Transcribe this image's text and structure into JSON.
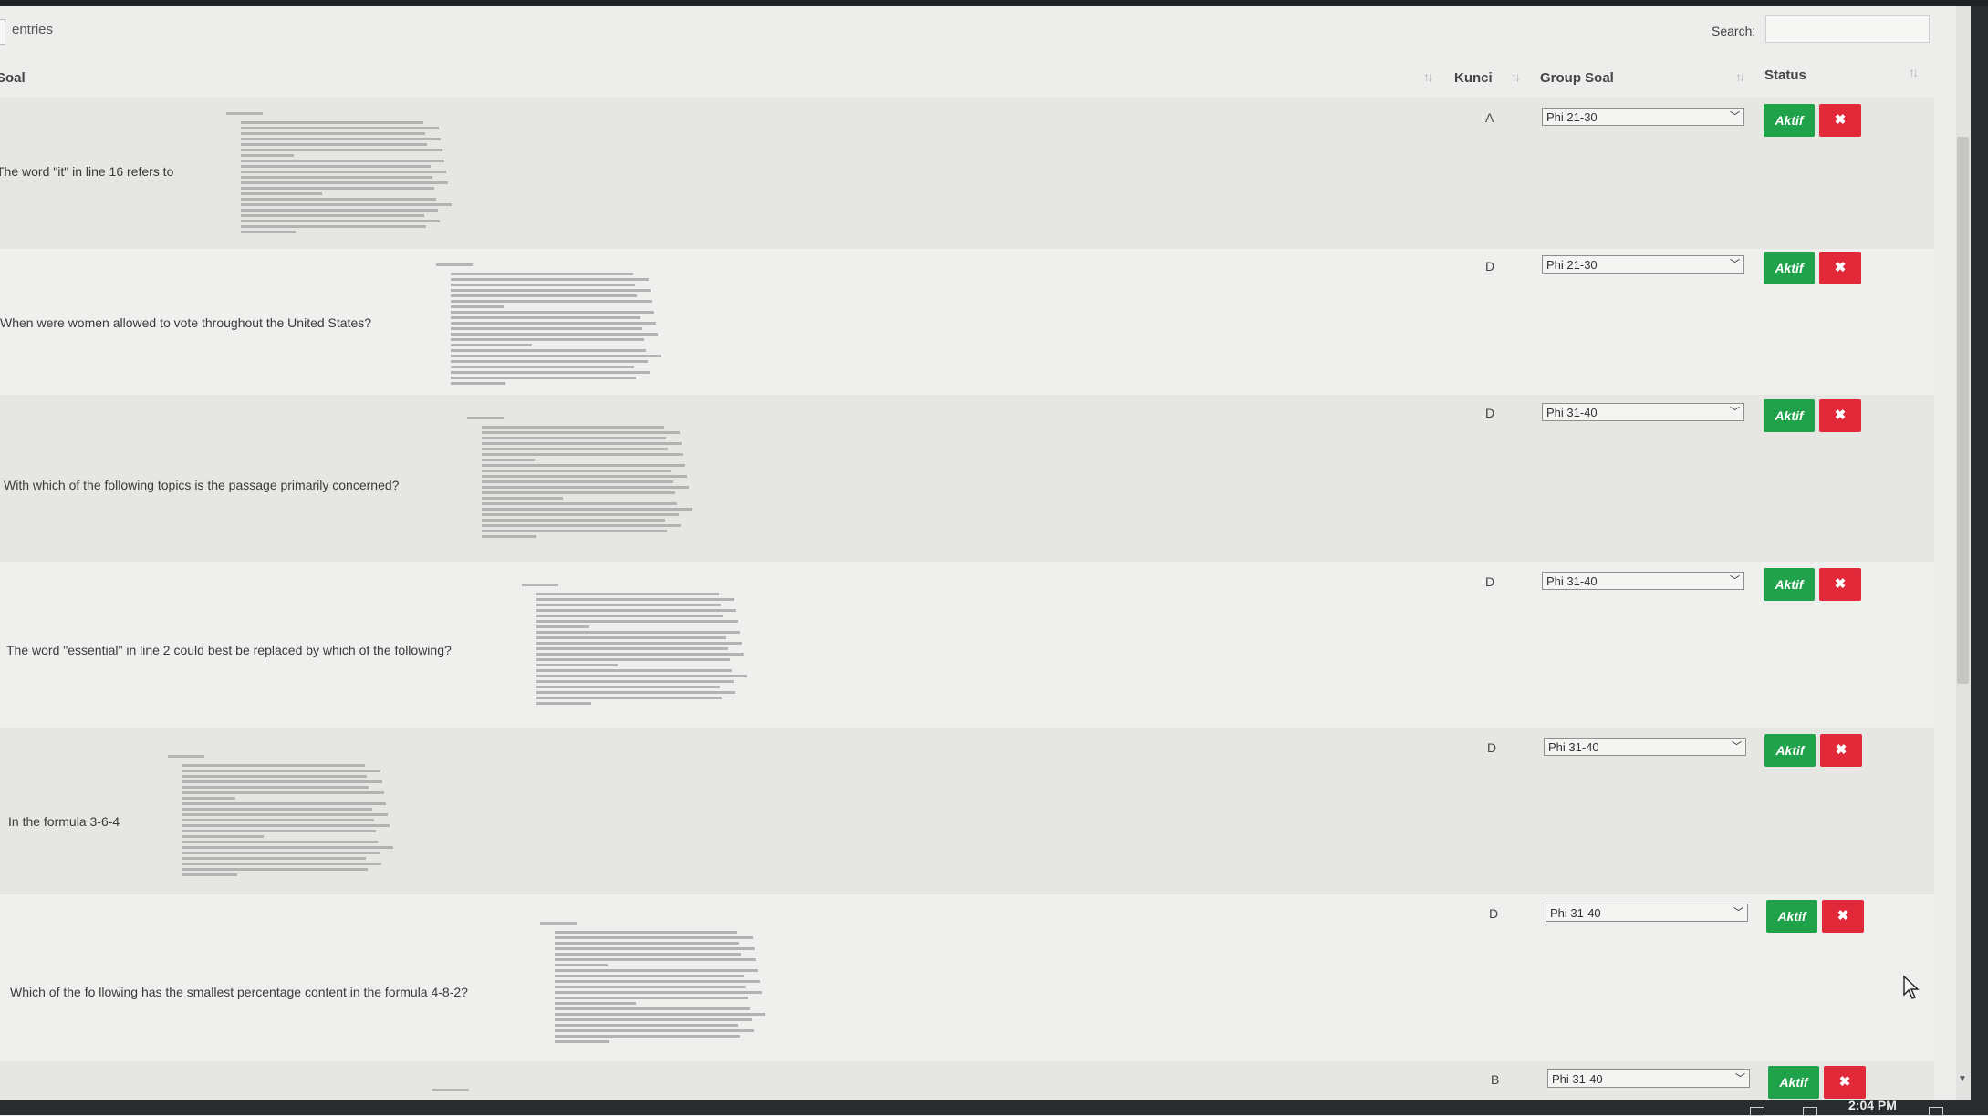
{
  "controls": {
    "entries_label": "entries",
    "search_label": "Search:",
    "search_value": ""
  },
  "table": {
    "headers": {
      "soal": "Soal",
      "kunci": "Kunci",
      "group_soal": "Group Soal",
      "status": "Status"
    },
    "rows": [
      {
        "question": "The word \"it\" in line 16 refers to",
        "kunci": "A",
        "group": "Phi 21-30",
        "status_label": "Aktif",
        "delete_label": "✖"
      },
      {
        "question": "When were women allowed to vote throughout the United States?",
        "kunci": "D",
        "group": "Phi 21-30",
        "status_label": "Aktif",
        "delete_label": "✖"
      },
      {
        "question": "With which of the following topics is the passage primarily concerned?",
        "kunci": "D",
        "group": "Phi 31-40",
        "status_label": "Aktif",
        "delete_label": "✖"
      },
      {
        "question": "The word \"essential\" in line 2 could best be replaced by which of the following?",
        "kunci": "D",
        "group": "Phi 31-40",
        "status_label": "Aktif",
        "delete_label": "✖"
      },
      {
        "question": "In the formula 3-6-4",
        "kunci": "D",
        "group": "Phi 31-40",
        "status_label": "Aktif",
        "delete_label": "✖"
      },
      {
        "question": "Which of the fo llowing has the smallest percentage content in the formula 4-8-2?",
        "kunci": "D",
        "group": "Phi 31-40",
        "status_label": "Aktif",
        "delete_label": "✖"
      },
      {
        "question": "",
        "kunci": "B",
        "group": "Phi 31-40",
        "status_label": "Aktif",
        "delete_label": "✖"
      }
    ]
  },
  "taskbar": {
    "clock": "2:04 PM"
  },
  "colors": {
    "aktif": "#1fa24a",
    "delete": "#e2293a",
    "background": "#ededeb",
    "taskbar": "#2a2d2f"
  },
  "icons": [
    "sort-icon",
    "chevron-down-icon",
    "close-icon",
    "cursor-icon",
    "scroll-down-icon"
  ]
}
